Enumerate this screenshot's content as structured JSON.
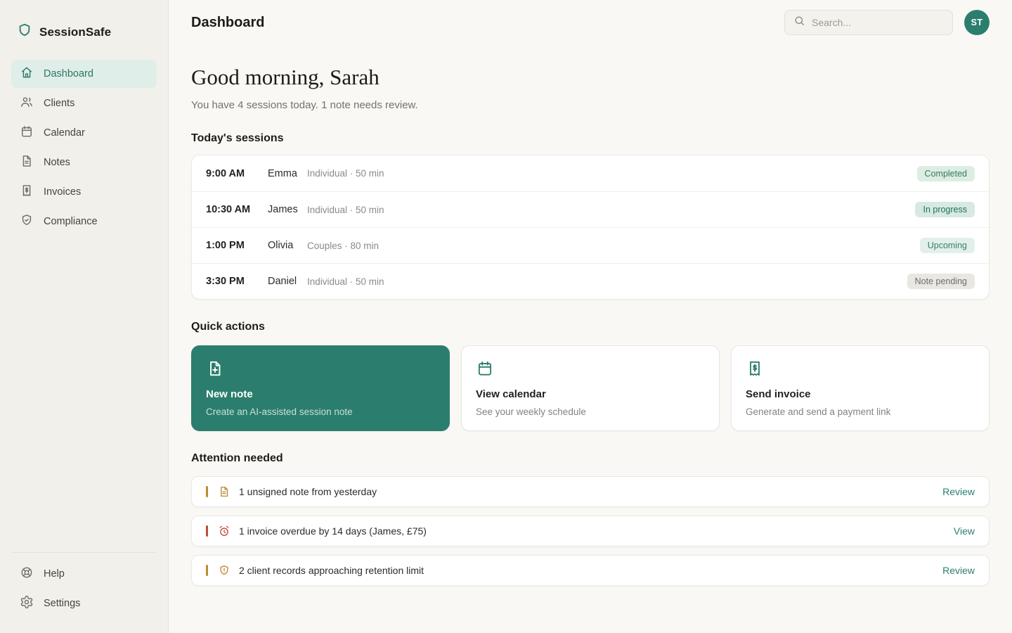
{
  "app": {
    "name": "SessionSafe"
  },
  "header": {
    "title": "Dashboard",
    "search_placeholder": "Search...",
    "avatar_initials": "ST"
  },
  "sidebar": {
    "items": [
      {
        "label": "Dashboard",
        "icon": "home-icon",
        "active": true
      },
      {
        "label": "Clients",
        "icon": "users-icon",
        "active": false
      },
      {
        "label": "Calendar",
        "icon": "calendar-icon",
        "active": false
      },
      {
        "label": "Notes",
        "icon": "file-text-icon",
        "active": false
      },
      {
        "label": "Invoices",
        "icon": "receipt-icon",
        "active": false
      },
      {
        "label": "Compliance",
        "icon": "shield-check-icon",
        "active": false
      }
    ],
    "footer": [
      {
        "label": "Help",
        "icon": "life-buoy-icon"
      },
      {
        "label": "Settings",
        "icon": "gear-icon"
      }
    ]
  },
  "greeting": {
    "title": "Good morning, Sarah",
    "subtitle": "You have 4 sessions today. 1 note needs review."
  },
  "sessions": {
    "heading": "Today's sessions",
    "rows": [
      {
        "time": "9:00 AM",
        "name": "Emma",
        "meta": "Individual · 50 min",
        "status": "Completed",
        "status_type": "completed"
      },
      {
        "time": "10:30 AM",
        "name": "James",
        "meta": "Individual · 50 min",
        "status": "In progress",
        "status_type": "in-progress"
      },
      {
        "time": "1:00 PM",
        "name": "Olivia",
        "meta": "Couples · 80 min",
        "status": "Upcoming",
        "status_type": "upcoming"
      },
      {
        "time": "3:30 PM",
        "name": "Daniel",
        "meta": "Individual · 50 min",
        "status": "Note pending",
        "status_type": "pending"
      }
    ]
  },
  "quick_actions": {
    "heading": "Quick actions",
    "cards": [
      {
        "title": "New note",
        "subtitle": "Create an AI-assisted session note",
        "icon": "file-plus-icon",
        "primary": true
      },
      {
        "title": "View calendar",
        "subtitle": "See your weekly schedule",
        "icon": "calendar-icon",
        "primary": false
      },
      {
        "title": "Send invoice",
        "subtitle": "Generate and send a payment link",
        "icon": "receipt-icon",
        "primary": false
      }
    ]
  },
  "attention": {
    "heading": "Attention needed",
    "items": [
      {
        "text": "1 unsigned note from yesterday",
        "action": "Review",
        "severity": "warning",
        "icon": "file-text-icon"
      },
      {
        "text": "1 invoice overdue by 14 days (James, £75)",
        "action": "View",
        "severity": "danger",
        "icon": "alarm-clock-icon"
      },
      {
        "text": "2 client records approaching retention limit",
        "action": "Review",
        "severity": "warning",
        "icon": "shield-alert-icon"
      }
    ]
  },
  "colors": {
    "brand_teal": "#2b7e6d",
    "active_nav_bg": "#dfeee8",
    "warning_amber": "#bd8a33",
    "danger_red": "#bf4a3f",
    "status_completed_text": "#39795b",
    "status_pending_text": "#6e6d67",
    "sidebar_bg": "#f1f0eb",
    "main_bg": "#f9f8f4"
  }
}
